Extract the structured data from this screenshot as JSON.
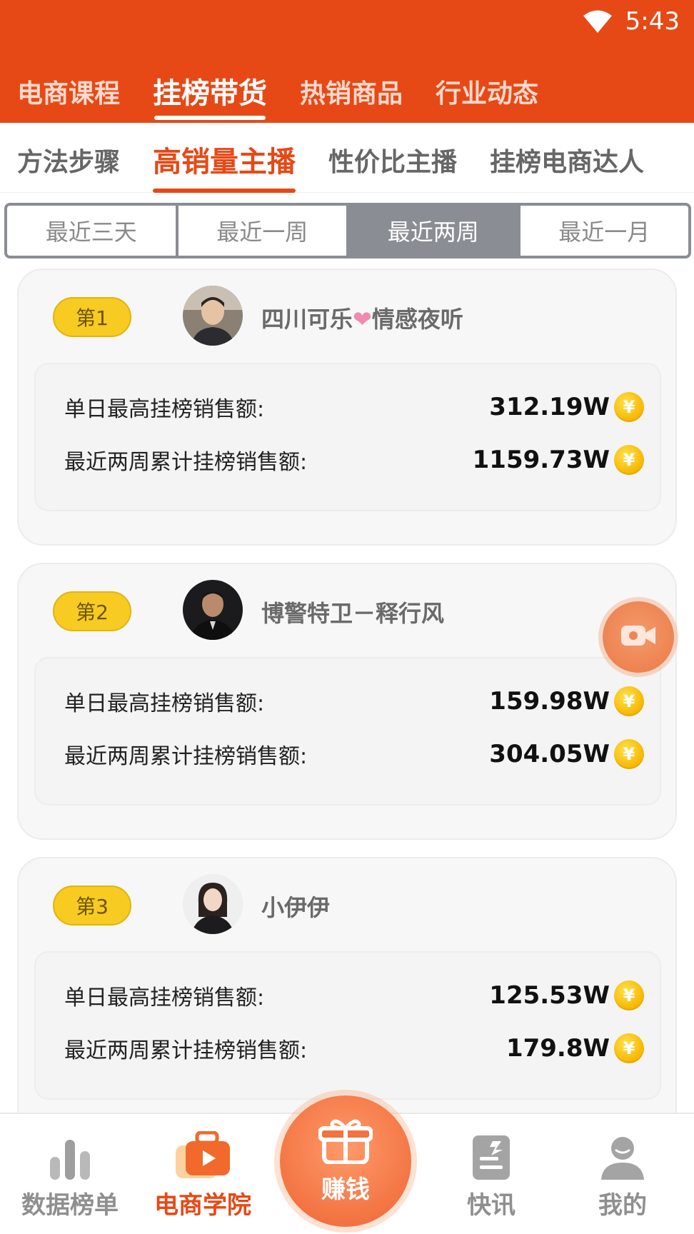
{
  "status_bar": {
    "time": "5:43",
    "wifi_icon": "wifi-icon"
  },
  "main_tabs": [
    {
      "label": "电商课程",
      "active": false
    },
    {
      "label": "挂榜带货",
      "active": true
    },
    {
      "label": "热销商品",
      "active": false
    },
    {
      "label": "行业动态",
      "active": false
    }
  ],
  "sub_tabs": [
    {
      "label": "方法步骤",
      "active": false
    },
    {
      "label": "高销量主播",
      "active": true
    },
    {
      "label": "性价比主播",
      "active": false
    },
    {
      "label": "挂榜电商达人",
      "active": false
    }
  ],
  "periods": [
    {
      "label": "最近三天",
      "active": false
    },
    {
      "label": "最近一周",
      "active": false
    },
    {
      "label": "最近两周",
      "active": true
    },
    {
      "label": "最近一月",
      "active": false
    }
  ],
  "stat_labels": {
    "daily_max": "单日最高挂榜销售额:",
    "period_total": "最近两周累计挂榜销售额:"
  },
  "coin_symbol": "¥",
  "rankings": [
    {
      "rank": "第1",
      "name_prefix": "四川可乐",
      "name_heart": "❤",
      "name_suffix": "情感夜听",
      "daily_max": "312.19W",
      "period_total": "1159.73W"
    },
    {
      "rank": "第2",
      "name_prefix": "博警特卫－释行风",
      "name_heart": "",
      "name_suffix": "",
      "daily_max": "159.98W",
      "period_total": "304.05W"
    },
    {
      "rank": "第3",
      "name_prefix": "小伊伊",
      "name_heart": "",
      "name_suffix": "",
      "daily_max": "125.53W",
      "period_total": "179.8W"
    }
  ],
  "bottom_nav": [
    {
      "label": "数据榜单",
      "icon": "bar-chart-icon",
      "active": false
    },
    {
      "label": "电商学院",
      "icon": "play-briefcase-icon",
      "active": true
    },
    {
      "label": "赚钱",
      "icon": "gift-box-icon",
      "active": false
    },
    {
      "label": "快讯",
      "icon": "news-icon",
      "active": false
    },
    {
      "label": "我的",
      "icon": "user-icon",
      "active": false
    }
  ],
  "colors": {
    "brand": "#e64916",
    "badge": "#f7cb22",
    "segment_active": "#8a8d93",
    "coin": "#f7b500"
  }
}
